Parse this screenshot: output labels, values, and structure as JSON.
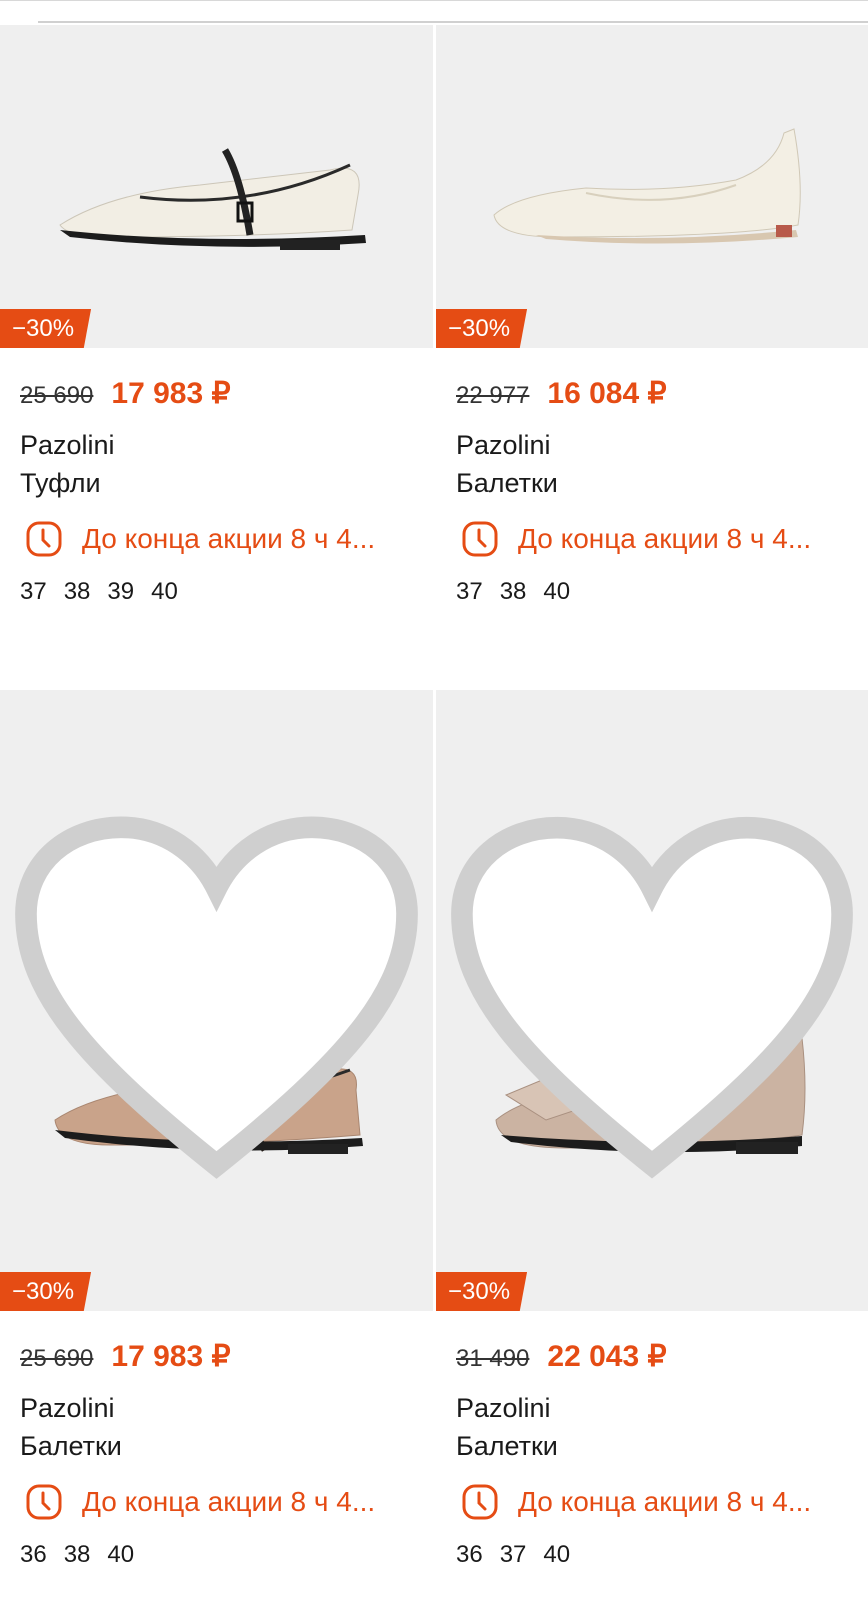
{
  "accent_color": "#e54c14",
  "products": [
    {
      "discount": "−30%",
      "old_price": "25 690",
      "new_price": "17 983 ₽",
      "brand": "Pazolini",
      "type": "Туфли",
      "timer": "До конца акции 8 ч 4...",
      "sizes": [
        "37",
        "38",
        "39",
        "40"
      ],
      "favorite_icon_visible": false
    },
    {
      "discount": "−30%",
      "old_price": "22 977",
      "new_price": "16 084 ₽",
      "brand": "Pazolini",
      "type": "Балетки",
      "timer": "До конца акции 8 ч 4...",
      "sizes": [
        "37",
        "38",
        "40"
      ],
      "favorite_icon_visible": false
    },
    {
      "discount": "−30%",
      "old_price": "25 690",
      "new_price": "17 983 ₽",
      "brand": "Pazolini",
      "type": "Балетки",
      "timer": "До конца акции 8 ч 4...",
      "sizes": [
        "36",
        "38",
        "40"
      ],
      "favorite_icon_visible": true
    },
    {
      "discount": "−30%",
      "old_price": "31 490",
      "new_price": "22 043 ₽",
      "brand": "Pazolini",
      "type": "Балетки",
      "timer": "До конца акции 8 ч 4...",
      "sizes": [
        "36",
        "37",
        "40"
      ],
      "favorite_icon_visible": true
    }
  ]
}
